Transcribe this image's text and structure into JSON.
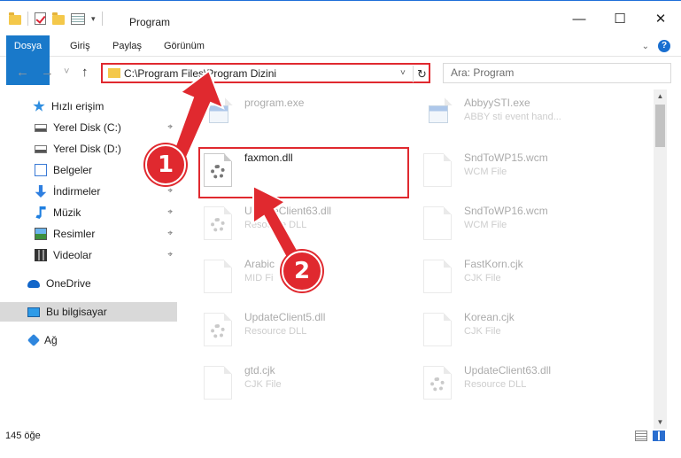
{
  "window": {
    "title": "Program",
    "minimize": "—",
    "maximize": "☐",
    "close": "✕"
  },
  "ribbon": {
    "tabs": [
      "Dosya",
      "Giriş",
      "Paylaş",
      "Görünüm"
    ]
  },
  "nav": {
    "back": "←",
    "forward": "→",
    "history": "˅",
    "up": "↑",
    "address": "C:\\Program Files\\Program Dizini",
    "address_dropdown": "˅",
    "refresh": "↻",
    "search_placeholder": "Ara: Program"
  },
  "sidebar": {
    "items": [
      {
        "label": "Hızlı erişim",
        "icon": "star-icon"
      },
      {
        "label": "Yerel Disk (C:)",
        "icon": "drive-icon",
        "pinned": true
      },
      {
        "label": "Yerel Disk (D:)",
        "icon": "drive-icon",
        "pinned": true
      },
      {
        "label": "Belgeler",
        "icon": "document-icon",
        "pinned": true
      },
      {
        "label": "İndirmeler",
        "icon": "download-icon",
        "pinned": true
      },
      {
        "label": "Müzik",
        "icon": "music-icon",
        "pinned": true
      },
      {
        "label": "Resimler",
        "icon": "pictures-icon",
        "pinned": true
      },
      {
        "label": "Videolar",
        "icon": "video-icon",
        "pinned": true
      },
      {
        "label": "OneDrive",
        "icon": "cloud-icon"
      },
      {
        "label": "Bu bilgisayar",
        "icon": "computer-icon",
        "selected": true
      },
      {
        "label": "Ağ",
        "icon": "network-icon"
      }
    ],
    "pin_glyph": "⌖"
  },
  "files": {
    "left": [
      {
        "name": "program.exe",
        "type": "",
        "icon": "exe-icon"
      },
      {
        "name": "faxmon.dll",
        "type": "",
        "icon": "dll-gear-icon",
        "highlighted": true
      },
      {
        "name": "UpdateClient63.dll",
        "type": "Resource DLL",
        "icon": "dll-gear-icon"
      },
      {
        "name": "Arabic",
        "type": "MID Fi",
        "icon": "file-icon"
      },
      {
        "name": "UpdateClient5.dll",
        "type": "Resource DLL",
        "icon": "dll-gear-icon"
      },
      {
        "name": "gtd.cjk",
        "type": "CJK File",
        "icon": "file-icon"
      }
    ],
    "right": [
      {
        "name": "AbbyySTI.exe",
        "type": "ABBY sti event hand...",
        "icon": "exe-icon"
      },
      {
        "name": "SndToWP15.wcm",
        "type": "WCM File",
        "icon": "file-icon"
      },
      {
        "name": "SndToWP16.wcm",
        "type": "WCM File",
        "icon": "file-icon"
      },
      {
        "name": "FastKorn.cjk",
        "type": "CJK File",
        "icon": "file-icon"
      },
      {
        "name": "Korean.cjk",
        "type": "CJK File",
        "icon": "file-icon"
      },
      {
        "name": "UpdateClient63.dll",
        "type": "Resource DLL",
        "icon": "dll-gear-icon"
      }
    ]
  },
  "status": {
    "count": "145 öğe"
  },
  "annotations": {
    "step1": "1",
    "step2": "2",
    "accent": "#e0292f"
  },
  "colors": {
    "file_tab": "#1979ca",
    "selection": "#d9d9d9"
  }
}
